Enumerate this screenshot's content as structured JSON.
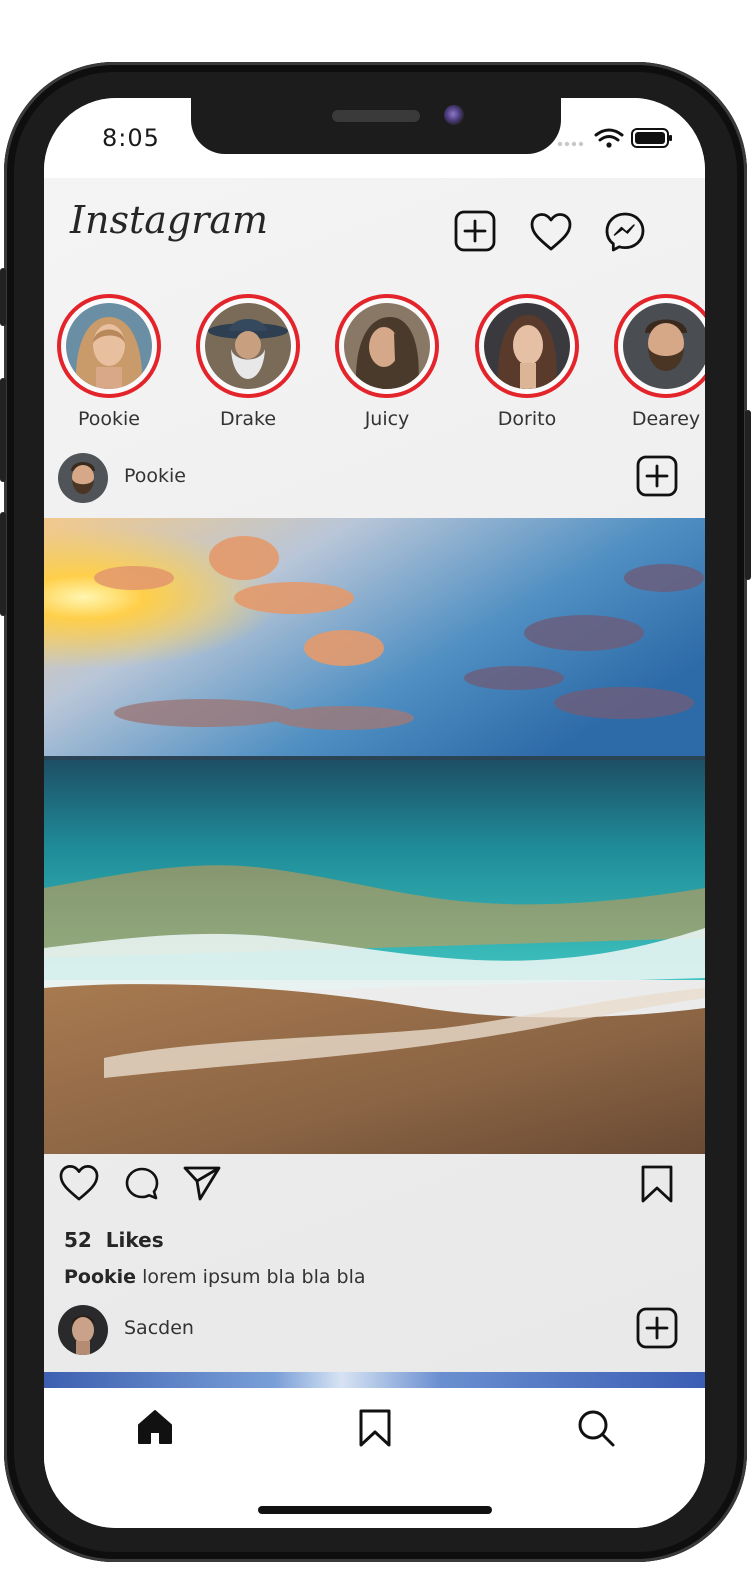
{
  "status_bar": {
    "time": "8:05"
  },
  "header": {
    "logo": "Instagram"
  },
  "stories": [
    {
      "name": "Pookie"
    },
    {
      "name": "Drake"
    },
    {
      "name": "Juicy"
    },
    {
      "name": "Dorito"
    },
    {
      "name": "Dearey"
    }
  ],
  "post": {
    "username": "Pookie",
    "likes_count": "52",
    "likes_label": "Likes",
    "caption_user": "Pookie",
    "caption_text": "lorem ipsum bla bla bla"
  },
  "next_post": {
    "username": "Sacden"
  },
  "icons": {
    "header": [
      "add-post-icon",
      "heart-icon",
      "messenger-icon"
    ],
    "post_actions": [
      "like-icon",
      "comment-icon",
      "share-icon",
      "bookmark-icon"
    ],
    "tabbar": [
      "home-icon",
      "saved-icon",
      "search-icon"
    ]
  },
  "colors": {
    "story_ring": "#e3242b",
    "tab_active": "#111111"
  }
}
